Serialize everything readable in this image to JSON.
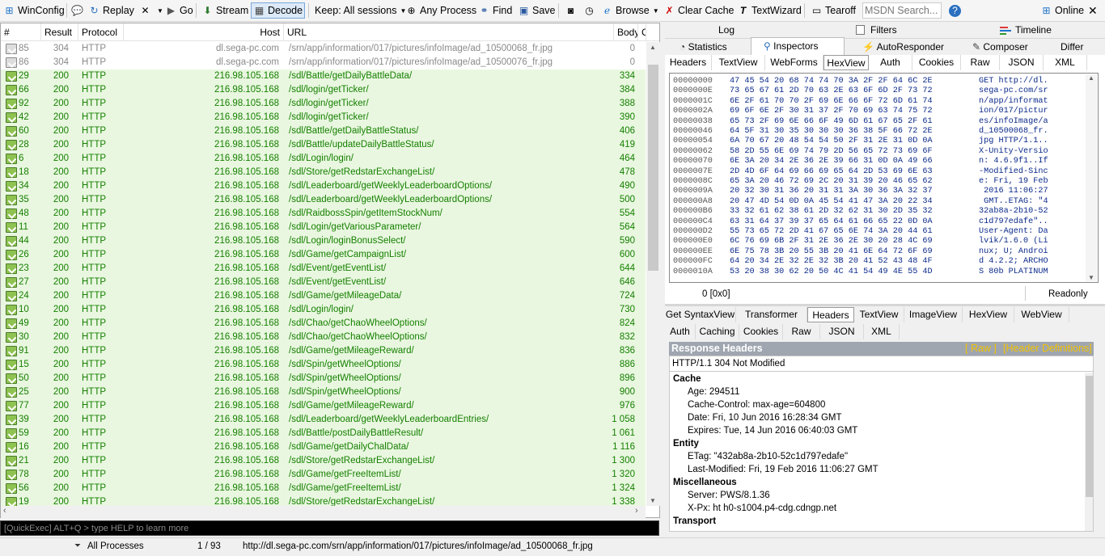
{
  "toolbar": {
    "items": [
      {
        "label": "WinConfig",
        "icon": "windows-icon"
      },
      {
        "label": "",
        "icon": "comment-icon"
      },
      {
        "label": "Replay",
        "icon": "replay-icon"
      },
      {
        "label": "",
        "icon": "remove-icon"
      },
      {
        "label": "Go",
        "icon": "go-icon"
      },
      {
        "label": "Stream",
        "icon": "stream-icon"
      },
      {
        "label": "Decode",
        "icon": "decode-icon"
      },
      {
        "label": "Keep: All sessions",
        "icon": ""
      },
      {
        "label": "Any Process",
        "icon": "crosshair-icon"
      },
      {
        "label": "Find",
        "icon": "binoculars-icon"
      },
      {
        "label": "Save",
        "icon": "save-icon"
      },
      {
        "label": "",
        "icon": "camera-icon"
      },
      {
        "label": "",
        "icon": "timer-icon"
      },
      {
        "label": "Browse",
        "icon": "browser-icon"
      },
      {
        "label": "Clear Cache",
        "icon": "clear-cache-icon"
      },
      {
        "label": "TextWizard",
        "icon": "textwizard-icon"
      },
      {
        "label": "Tearoff",
        "icon": "tearoff-icon"
      },
      {
        "label": "MSDN Search...",
        "icon": ""
      },
      {
        "label": "",
        "icon": "help-icon"
      },
      {
        "label": "Online",
        "icon": "online-icon"
      }
    ]
  },
  "sessions": {
    "columns": [
      "#",
      "Result",
      "Protocol",
      "Host",
      "URL",
      "Body",
      "C"
    ],
    "rows": [
      {
        "id": "85",
        "result": "304",
        "protocol": "HTTP",
        "host": "dl.sega-pc.com",
        "url": "/srn/app/information/017/pictures/infoImage/ad_10500068_fr.jpg",
        "body": "0",
        "style": "n"
      },
      {
        "id": "86",
        "result": "304",
        "protocol": "HTTP",
        "host": "dl.sega-pc.com",
        "url": "/srn/app/information/017/pictures/infoImage/ad_10500076_fr.jpg",
        "body": "0",
        "style": "n"
      },
      {
        "id": "29",
        "result": "200",
        "protocol": "HTTP",
        "host": "216.98.105.168",
        "url": "/sdl/Battle/getDailyBattleData/",
        "body": "334",
        "style": "g"
      },
      {
        "id": "66",
        "result": "200",
        "protocol": "HTTP",
        "host": "216.98.105.168",
        "url": "/sdl/login/getTicker/",
        "body": "384",
        "style": "g"
      },
      {
        "id": "92",
        "result": "200",
        "protocol": "HTTP",
        "host": "216.98.105.168",
        "url": "/sdl/login/getTicker/",
        "body": "388",
        "style": "g"
      },
      {
        "id": "42",
        "result": "200",
        "protocol": "HTTP",
        "host": "216.98.105.168",
        "url": "/sdl/login/getTicker/",
        "body": "390",
        "style": "g"
      },
      {
        "id": "60",
        "result": "200",
        "protocol": "HTTP",
        "host": "216.98.105.168",
        "url": "/sdl/Battle/getDailyBattleStatus/",
        "body": "406",
        "style": "g"
      },
      {
        "id": "28",
        "result": "200",
        "protocol": "HTTP",
        "host": "216.98.105.168",
        "url": "/sdl/Battle/updateDailyBattleStatus/",
        "body": "419",
        "style": "g"
      },
      {
        "id": "6",
        "result": "200",
        "protocol": "HTTP",
        "host": "216.98.105.168",
        "url": "/sdl/Login/login/",
        "body": "464",
        "style": "g"
      },
      {
        "id": "18",
        "result": "200",
        "protocol": "HTTP",
        "host": "216.98.105.168",
        "url": "/sdl/Store/getRedstarExchangeList/",
        "body": "478",
        "style": "g"
      },
      {
        "id": "34",
        "result": "200",
        "protocol": "HTTP",
        "host": "216.98.105.168",
        "url": "/sdl/Leaderboard/getWeeklyLeaderboardOptions/",
        "body": "490",
        "style": "g"
      },
      {
        "id": "35",
        "result": "200",
        "protocol": "HTTP",
        "host": "216.98.105.168",
        "url": "/sdl/Leaderboard/getWeeklyLeaderboardOptions/",
        "body": "500",
        "style": "g"
      },
      {
        "id": "48",
        "result": "200",
        "protocol": "HTTP",
        "host": "216.98.105.168",
        "url": "/sdl/RaidbossSpin/getItemStockNum/",
        "body": "554",
        "style": "g"
      },
      {
        "id": "11",
        "result": "200",
        "protocol": "HTTP",
        "host": "216.98.105.168",
        "url": "/sdl/Login/getVariousParameter/",
        "body": "564",
        "style": "g"
      },
      {
        "id": "44",
        "result": "200",
        "protocol": "HTTP",
        "host": "216.98.105.168",
        "url": "/sdl/Login/loginBonusSelect/",
        "body": "590",
        "style": "g"
      },
      {
        "id": "26",
        "result": "200",
        "protocol": "HTTP",
        "host": "216.98.105.168",
        "url": "/sdl/Game/getCampaignList/",
        "body": "600",
        "style": "g"
      },
      {
        "id": "23",
        "result": "200",
        "protocol": "HTTP",
        "host": "216.98.105.168",
        "url": "/sdl/Event/getEventList/",
        "body": "644",
        "style": "g"
      },
      {
        "id": "27",
        "result": "200",
        "protocol": "HTTP",
        "host": "216.98.105.168",
        "url": "/sdl/Event/getEventList/",
        "body": "646",
        "style": "g"
      },
      {
        "id": "24",
        "result": "200",
        "protocol": "HTTP",
        "host": "216.98.105.168",
        "url": "/sdl/Game/getMileageData/",
        "body": "724",
        "style": "g"
      },
      {
        "id": "10",
        "result": "200",
        "protocol": "HTTP",
        "host": "216.98.105.168",
        "url": "/sdl/Login/login/",
        "body": "730",
        "style": "g"
      },
      {
        "id": "49",
        "result": "200",
        "protocol": "HTTP",
        "host": "216.98.105.168",
        "url": "/sdl/Chao/getChaoWheelOptions/",
        "body": "824",
        "style": "g"
      },
      {
        "id": "30",
        "result": "200",
        "protocol": "HTTP",
        "host": "216.98.105.168",
        "url": "/sdl/Chao/getChaoWheelOptions/",
        "body": "832",
        "style": "g"
      },
      {
        "id": "91",
        "result": "200",
        "protocol": "HTTP",
        "host": "216.98.105.168",
        "url": "/sdl/Game/getMileageReward/",
        "body": "836",
        "style": "g"
      },
      {
        "id": "15",
        "result": "200",
        "protocol": "HTTP",
        "host": "216.98.105.168",
        "url": "/sdl/Spin/getWheelOptions/",
        "body": "886",
        "style": "g"
      },
      {
        "id": "50",
        "result": "200",
        "protocol": "HTTP",
        "host": "216.98.105.168",
        "url": "/sdl/Spin/getWheelOptions/",
        "body": "896",
        "style": "g"
      },
      {
        "id": "25",
        "result": "200",
        "protocol": "HTTP",
        "host": "216.98.105.168",
        "url": "/sdl/Spin/getWheelOptions/",
        "body": "900",
        "style": "g"
      },
      {
        "id": "77",
        "result": "200",
        "protocol": "HTTP",
        "host": "216.98.105.168",
        "url": "/sdl/Game/getMileageReward/",
        "body": "976",
        "style": "g"
      },
      {
        "id": "39",
        "result": "200",
        "protocol": "HTTP",
        "host": "216.98.105.168",
        "url": "/sdl/Leaderboard/getWeeklyLeaderboardEntries/",
        "body": "1 058",
        "style": "g"
      },
      {
        "id": "59",
        "result": "200",
        "protocol": "HTTP",
        "host": "216.98.105.168",
        "url": "/sdl/Battle/postDailyBattleResult/",
        "body": "1 061",
        "style": "g"
      },
      {
        "id": "16",
        "result": "200",
        "protocol": "HTTP",
        "host": "216.98.105.168",
        "url": "/sdl/Game/getDailyChalData/",
        "body": "1 116",
        "style": "g"
      },
      {
        "id": "21",
        "result": "200",
        "protocol": "HTTP",
        "host": "216.98.105.168",
        "url": "/sdl/Store/getRedstarExchangeList/",
        "body": "1 300",
        "style": "g"
      },
      {
        "id": "78",
        "result": "200",
        "protocol": "HTTP",
        "host": "216.98.105.168",
        "url": "/sdl/Game/getFreeItemList/",
        "body": "1 320",
        "style": "g"
      },
      {
        "id": "56",
        "result": "200",
        "protocol": "HTTP",
        "host": "216.98.105.168",
        "url": "/sdl/Game/getFreeItemList/",
        "body": "1 324",
        "style": "g"
      },
      {
        "id": "19",
        "result": "200",
        "protocol": "HTTP",
        "host": "216.98.105.168",
        "url": "/sdl/Store/getRedstarExchangeList/",
        "body": "1 338",
        "style": "g"
      }
    ]
  },
  "right": {
    "top_tabs": [
      {
        "label": "Log",
        "icon": "log-icon"
      },
      {
        "label": "Filters",
        "icon": "filters-icon"
      },
      {
        "label": "Timeline",
        "icon": "timeline-icon"
      }
    ],
    "main_tabs": [
      {
        "label": "Statistics",
        "icon": "statistics-icon"
      },
      {
        "label": "Inspectors",
        "icon": "inspectors-icon"
      },
      {
        "label": "AutoResponder",
        "icon": "autoresponder-icon"
      },
      {
        "label": "Composer",
        "icon": "composer-icon"
      },
      {
        "label": "Differ",
        "icon": ""
      }
    ],
    "request_tabs": [
      "Headers",
      "TextView",
      "WebForms",
      "HexView",
      "Auth",
      "Cookies",
      "Raw",
      "JSON",
      "XML"
    ],
    "hex": [
      {
        "off": "00000000",
        "bytes": "47 45 54 20 68 74 74 70 3A 2F 2F 64 6C 2E",
        "ascii": "GET http://dl."
      },
      {
        "off": "0000000E",
        "bytes": "73 65 67 61 2D 70 63 2E 63 6F 6D 2F 73 72",
        "ascii": "sega-pc.com/sr"
      },
      {
        "off": "0000001C",
        "bytes": "6E 2F 61 70 70 2F 69 6E 66 6F 72 6D 61 74",
        "ascii": "n/app/informat"
      },
      {
        "off": "0000002A",
        "bytes": "69 6F 6E 2F 30 31 37 2F 70 69 63 74 75 72",
        "ascii": "ion/017/pictur"
      },
      {
        "off": "00000038",
        "bytes": "65 73 2F 69 6E 66 6F 49 6D 61 67 65 2F 61",
        "ascii": "es/infoImage/a"
      },
      {
        "off": "00000046",
        "bytes": "64 5F 31 30 35 30 30 30 36 38 5F 66 72 2E",
        "ascii": "d_10500068_fr."
      },
      {
        "off": "00000054",
        "bytes": "6A 70 67 20 48 54 54 50 2F 31 2E 31 0D 0A",
        "ascii": "jpg HTTP/1.1.."
      },
      {
        "off": "00000062",
        "bytes": "58 2D 55 6E 69 74 79 2D 56 65 72 73 69 6F",
        "ascii": "X-Unity-Versio"
      },
      {
        "off": "00000070",
        "bytes": "6E 3A 20 34 2E 36 2E 39 66 31 0D 0A 49 66",
        "ascii": "n: 4.6.9f1..If"
      },
      {
        "off": "0000007E",
        "bytes": "2D 4D 6F 64 69 66 69 65 64 2D 53 69 6E 63",
        "ascii": "-Modified-Sinc"
      },
      {
        "off": "0000008C",
        "bytes": "65 3A 20 46 72 69 2C 20 31 39 20 46 65 62",
        "ascii": "e: Fri, 19 Feb"
      },
      {
        "off": "0000009A",
        "bytes": "20 32 30 31 36 20 31 31 3A 30 36 3A 32 37",
        "ascii": " 2016 11:06:27"
      },
      {
        "off": "000000A8",
        "bytes": "20 47 4D 54 0D 0A 45 54 41 47 3A 20 22 34",
        "ascii": " GMT..ETAG: \"4"
      },
      {
        "off": "000000B6",
        "bytes": "33 32 61 62 38 61 2D 32 62 31 30 2D 35 32",
        "ascii": "32ab8a-2b10-52"
      },
      {
        "off": "000000C4",
        "bytes": "63 31 64 37 39 37 65 64 61 66 65 22 0D 0A",
        "ascii": "c1d797edafe\".."
      },
      {
        "off": "000000D2",
        "bytes": "55 73 65 72 2D 41 67 65 6E 74 3A 20 44 61",
        "ascii": "User-Agent: Da"
      },
      {
        "off": "000000E0",
        "bytes": "6C 76 69 6B 2F 31 2E 36 2E 30 20 28 4C 69",
        "ascii": "lvik/1.6.0 (Li"
      },
      {
        "off": "000000EE",
        "bytes": "6E 75 78 3B 20 55 3B 20 41 6E 64 72 6F 69",
        "ascii": "nux; U; Androi"
      },
      {
        "off": "000000FC",
        "bytes": "64 20 34 2E 32 2E 32 3B 20 41 52 43 48 4F",
        "ascii": "d 4.2.2; ARCHO"
      },
      {
        "off": "0000010A",
        "bytes": "53 20 38 30 62 20 50 4C 41 54 49 4E 55 4D",
        "ascii": "S 80b PLATINUM"
      }
    ],
    "hex_footer_left": "0 [0x0]",
    "hex_footer_right": "Readonly",
    "response_tabs_row1": [
      "Get SyntaxView",
      "Transformer",
      "Headers",
      "TextView",
      "ImageView",
      "HexView",
      "WebView"
    ],
    "response_tabs_row2": [
      "Auth",
      "Caching",
      "Cookies",
      "Raw",
      "JSON",
      "XML"
    ],
    "response_header_title": "Response Headers",
    "raw_link": "[ Raw ]",
    "header_def_link": "[Header Definitions]",
    "status_line": "HTTP/1.1 304 Not Modified",
    "groups": [
      {
        "name": "Cache",
        "items": [
          "Age: 294511",
          "Cache-Control: max-age=604800",
          "Date: Fri, 10 Jun 2016 16:28:34 GMT",
          "Expires: Tue, 14 Jun 2016 06:40:03 GMT"
        ]
      },
      {
        "name": "Entity",
        "items": [
          "ETag: \"432ab8a-2b10-52c1d797edafe\"",
          "Last-Modified: Fri, 19 Feb 2016 11:06:27 GMT"
        ]
      },
      {
        "name": "Miscellaneous",
        "items": [
          "Server: PWS/8.1.36",
          "X-Px: ht h0-s1004.p4-cdg.cdngp.net"
        ]
      },
      {
        "name": "Transport",
        "items": []
      }
    ]
  },
  "quickexec": "[QuickExec] ALT+Q > type HELP to learn more",
  "statusbar": {
    "process": "All Processes",
    "count": "1 / 93",
    "url": "http://dl.sega-pc.com/srn/app/information/017/pictures/infoImage/ad_10500068_fr.jpg"
  },
  "colors": {
    "green_text": "#158000",
    "green_bg": "#e9f7e0",
    "hex_text": "#0b2a8a",
    "accent": "#c79a00"
  }
}
